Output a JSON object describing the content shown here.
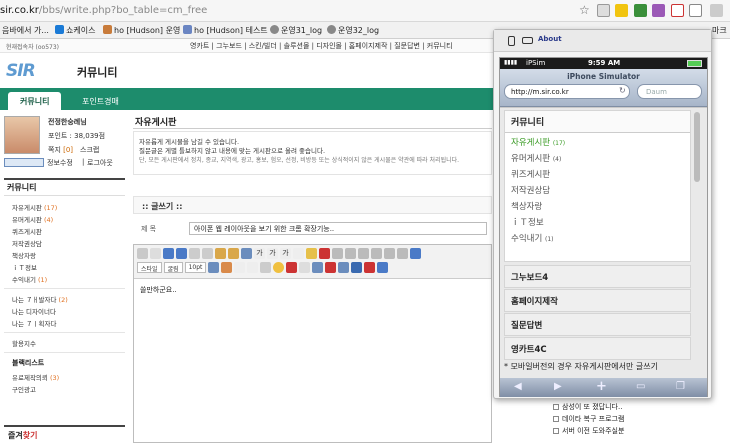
{
  "browser": {
    "url_host": "sir.co.kr",
    "url_path": "/bbs/write.php?bo_table=cm_free",
    "bookmarks": [
      {
        "label": "음바에서 가..."
      },
      {
        "label": "쇼케이스"
      },
      {
        "label": "ho [Hudson] 운영"
      },
      {
        "label": "ho [Hudson] 테스트"
      },
      {
        "label": "운영31_log"
      },
      {
        "label": "운영32_log"
      }
    ],
    "bookmarks_right": "마크"
  },
  "site": {
    "topline_left": "현재접속자 (oo573)",
    "topline_menu": "영카트  |  그누보드  |  스킨/빌더  |  솔루션몰  |  디자인몰  |  홈페이지제작  |  질문답변  |  커뮤니티",
    "logo": "SIR",
    "logo_title": "커뮤니티",
    "tabs": [
      {
        "label": "커뮤니티",
        "active": true
      },
      {
        "label": "포인트경매",
        "active": false
      }
    ]
  },
  "profile": {
    "name": "전정한숭례님",
    "point": "포인트 : 38,039점",
    "memo_label": "쪽지",
    "memo_count": "[0]",
    "scrap": "스크랩",
    "edit": "정보수정",
    "logout": "로그아웃"
  },
  "leftmenu": {
    "heading": "커뮤니티",
    "items": [
      {
        "label": "자유게시판",
        "count": "(17)"
      },
      {
        "label": "유머게시판",
        "count": "(4)"
      },
      {
        "label": "퀴즈게시판",
        "count": ""
      },
      {
        "label": "저작권상담",
        "count": ""
      },
      {
        "label": "책상자랑",
        "count": ""
      },
      {
        "label": "ｉＴ정보",
        "count": ""
      },
      {
        "label": "수익내기",
        "count": "(1)"
      }
    ],
    "items2": [
      {
        "label": "나는 ７ㅐ발자다",
        "count": "(2)"
      },
      {
        "label": "나는 디자이너다",
        "count": ""
      },
      {
        "label": "나는 ７ㅣ획자다",
        "count": ""
      }
    ],
    "single": "할용지수",
    "black_heading": "블랙리스트",
    "black_items": [
      {
        "label": "유료제작의뢰",
        "count": "(3)"
      },
      {
        "label": "구인광고",
        "count": ""
      }
    ],
    "favorites_prefix": "즐겨",
    "favorites_suffix": "찾기"
  },
  "main": {
    "board_title": "자유게시판",
    "notice_line1": "자유롭게 게시물을 남길 수 있습니다.",
    "notice_line2": "질문글은 게별 틀보하지 않고 내용에 맞는 게시판으로 올려 좋습니다.",
    "notice_line3": "단, 모든 게시판에서 정치, 종교, 지역색, 광고, 홍보, 험오, 선정, 비방등 또는 상식적이지 않은 게시물은 약관에 따라 처리됩니다.",
    "write_heading": ":: 글쓰기 ::",
    "subject_label": "제 목",
    "subject_value": "아이폰 웹 레이아웃을 보기 위한 크롬 확장기능..",
    "toolbar_style": "스타일",
    "toolbar_font": "굴림",
    "toolbar_size": "10pt",
    "editor_text": "쓸만하군요.."
  },
  "popup": {
    "about": "About",
    "carrier": "iPSim",
    "time": "9:59 AM",
    "sim_title": "iPhone Simulator",
    "url": "http://m.sir.co.kr",
    "search_placeholder": "Daum",
    "list_heading": "커뮤니티",
    "list": [
      {
        "label": "자유게시판",
        "count": "(17)"
      },
      {
        "label": "유머게시판",
        "count": "(4)"
      },
      {
        "label": "퀴즈게시판",
        "count": ""
      },
      {
        "label": "저작권상담",
        "count": ""
      },
      {
        "label": "책상자랑",
        "count": ""
      },
      {
        "label": "ｉＴ정보",
        "count": ""
      },
      {
        "label": "수익내기",
        "count": "(1)"
      }
    ],
    "rows": [
      "그누보드4",
      "홈페이지제작",
      "질문답변",
      "영카트4C"
    ],
    "note": "* 모바일버전의 경우 자유게시판에서만 글쓰기"
  },
  "under_list": [
    "삼성이 또 졌답니다..",
    "데이타 복구 프로그램",
    "서버 이전 도와주실분"
  ],
  "colors": {
    "nav": "#1d8c6c",
    "accent_count": "#e07020",
    "green_text": "#3a9b25"
  }
}
